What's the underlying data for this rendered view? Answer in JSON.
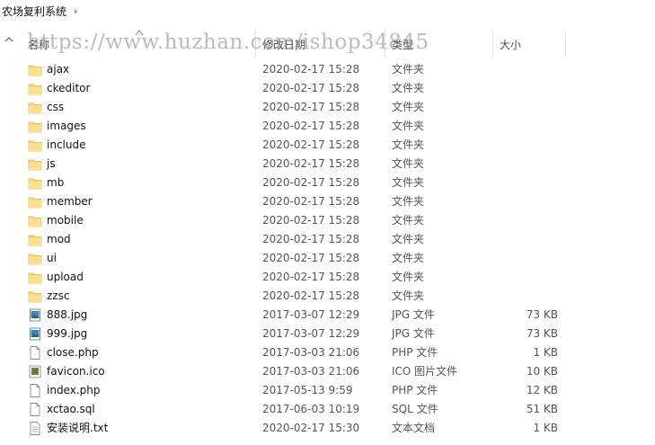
{
  "breadcrumb": {
    "folder": "农场复利系统",
    "chevron": "›"
  },
  "header": {
    "name": "名称",
    "modified": "修改日期",
    "type": "类型",
    "size": "大小"
  },
  "watermark": "https://www.huzhan.com/ishop34845",
  "files": [
    {
      "name": "ajax",
      "date": "2020-02-17 15:28",
      "type": "文件夹",
      "size": "",
      "icon": "folder-icon"
    },
    {
      "name": "ckeditor",
      "date": "2020-02-17 15:28",
      "type": "文件夹",
      "size": "",
      "icon": "folder-icon"
    },
    {
      "name": "css",
      "date": "2020-02-17 15:28",
      "type": "文件夹",
      "size": "",
      "icon": "folder-icon"
    },
    {
      "name": "images",
      "date": "2020-02-17 15:28",
      "type": "文件夹",
      "size": "",
      "icon": "folder-icon"
    },
    {
      "name": "include",
      "date": "2020-02-17 15:28",
      "type": "文件夹",
      "size": "",
      "icon": "folder-icon"
    },
    {
      "name": "js",
      "date": "2020-02-17 15:28",
      "type": "文件夹",
      "size": "",
      "icon": "folder-icon"
    },
    {
      "name": "mb",
      "date": "2020-02-17 15:28",
      "type": "文件夹",
      "size": "",
      "icon": "folder-icon"
    },
    {
      "name": "member",
      "date": "2020-02-17 15:28",
      "type": "文件夹",
      "size": "",
      "icon": "folder-icon"
    },
    {
      "name": "mobile",
      "date": "2020-02-17 15:28",
      "type": "文件夹",
      "size": "",
      "icon": "folder-icon"
    },
    {
      "name": "mod",
      "date": "2020-02-17 15:28",
      "type": "文件夹",
      "size": "",
      "icon": "folder-icon"
    },
    {
      "name": "ui",
      "date": "2020-02-17 15:28",
      "type": "文件夹",
      "size": "",
      "icon": "folder-icon"
    },
    {
      "name": "upload",
      "date": "2020-02-17 15:28",
      "type": "文件夹",
      "size": "",
      "icon": "folder-icon"
    },
    {
      "name": "zzsc",
      "date": "2020-02-17 15:28",
      "type": "文件夹",
      "size": "",
      "icon": "folder-icon"
    },
    {
      "name": "888.jpg",
      "date": "2017-03-07 12:29",
      "type": "JPG 文件",
      "size": "73 KB",
      "icon": "image-file-icon"
    },
    {
      "name": "999.jpg",
      "date": "2017-03-07 12:29",
      "type": "JPG 文件",
      "size": "73 KB",
      "icon": "image-file-icon"
    },
    {
      "name": "close.php",
      "date": "2017-03-03 21:06",
      "type": "PHP 文件",
      "size": "1 KB",
      "icon": "document-icon"
    },
    {
      "name": "favicon.ico",
      "date": "2017-03-03 21:06",
      "type": "ICO 图片文件",
      "size": "10 KB",
      "icon": "favicon-file-icon"
    },
    {
      "name": "index.php",
      "date": "2017-05-13 9:59",
      "type": "PHP 文件",
      "size": "12 KB",
      "icon": "document-icon"
    },
    {
      "name": "xctao.sql",
      "date": "2017-06-03 10:19",
      "type": "SQL 文件",
      "size": "51 KB",
      "icon": "document-icon"
    },
    {
      "name": "安装说明.txt",
      "date": "2020-02-17 15:30",
      "type": "文本文档",
      "size": "1 KB",
      "icon": "text-file-icon"
    }
  ]
}
